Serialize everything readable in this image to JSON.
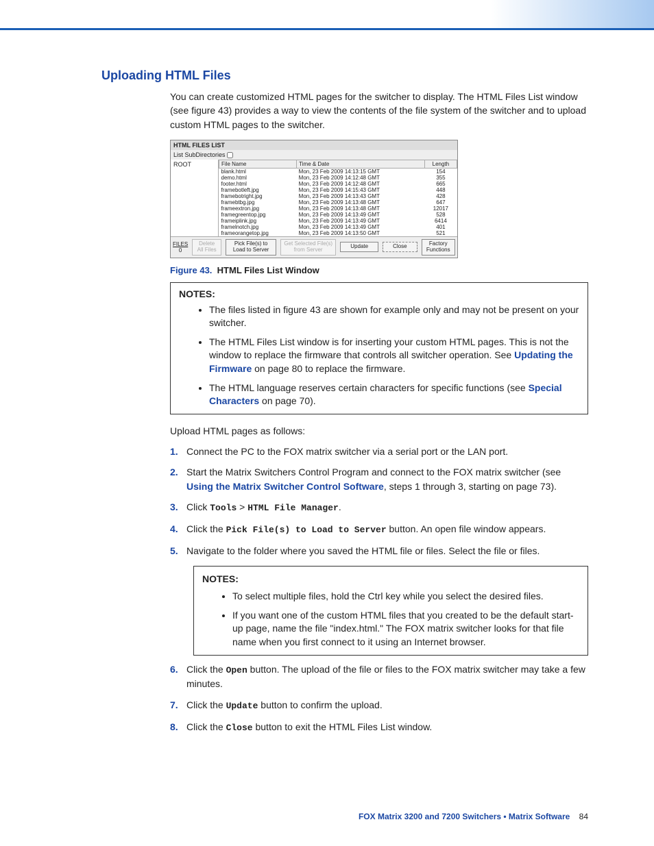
{
  "heading": "Uploading HTML Files",
  "intro": "You can create customized HTML pages for the switcher to display. The HTML Files List window (see figure 43) provides a way to view the contents of the file system of the switcher and to upload custom HTML pages to the switcher.",
  "window": {
    "title": "HTML FILES LIST",
    "subdir_label": "List SubDirectories",
    "root": "ROOT",
    "cols": {
      "name": "File Name",
      "date": "Time & Date",
      "len": "Length"
    },
    "rows": [
      {
        "name": "blank.html",
        "date": "Mon, 23 Feb 2009 14:13:15 GMT",
        "len": "154"
      },
      {
        "name": "demo.html",
        "date": "Mon, 23 Feb 2009 14:12:48 GMT",
        "len": "355"
      },
      {
        "name": "footer.html",
        "date": "Mon, 23 Feb 2009 14:12:48 GMT",
        "len": "665"
      },
      {
        "name": "framebotleft.jpg",
        "date": "Mon, 23 Feb 2009 14:15:43 GMT",
        "len": "448"
      },
      {
        "name": "framebotright.jpg",
        "date": "Mon, 23 Feb 2009 14:13:43 GMT",
        "len": "428"
      },
      {
        "name": "framebtbg.jpg",
        "date": "Mon, 23 Feb 2009 14:13:48 GMT",
        "len": "647"
      },
      {
        "name": "frameextron.jpg",
        "date": "Mon, 23 Feb 2009 14:13:48 GMT",
        "len": "12017"
      },
      {
        "name": "framegreentop.jpg",
        "date": "Mon, 23 Feb 2009 14:13:49 GMT",
        "len": "528"
      },
      {
        "name": "frameiplink.jpg",
        "date": "Mon, 23 Feb 2009 14:13:49 GMT",
        "len": "6414"
      },
      {
        "name": "framelnotch.jpg",
        "date": "Mon, 23 Feb 2009 14:13:49 GMT",
        "len": "401"
      },
      {
        "name": "frameorangetop.jpg",
        "date": "Mon, 23 Feb 2009 14:13:50 GMT",
        "len": "521"
      }
    ],
    "files_count_label": "FILES",
    "files_count": "0",
    "btn_delete": "Delete All\nFiles",
    "btn_pick": "Pick File(s) to\nLoad to Server",
    "btn_getsel": "Get Selected\nFile(s) from Server",
    "btn_update": "Update",
    "btn_close": "Close",
    "btn_restore": "Factory\nFunctions"
  },
  "caption_label": "Figure 43.",
  "caption_text": "HTML Files List Window",
  "notes_label": "NOTES:",
  "notes1": {
    "i1": "The files listed in figure 43 are shown for example only and may not be present on your switcher.",
    "i2a": "The HTML Files List window is for inserting your custom HTML pages. This is not the window to replace the firmware that controls all switcher operation. See ",
    "i2link": "Updating the Firmware",
    "i2b": " on page 80 to replace the firmware.",
    "i3a": "The HTML language reserves certain characters for specific functions (see ",
    "i3link": "Special Characters",
    "i3b": " on page 70)."
  },
  "upload_para": "Upload HTML pages as follows:",
  "steps": {
    "s1": "Connect the PC to the FOX matrix switcher via a serial port or the LAN port.",
    "s2a": "Start the Matrix Switchers Control Program and connect to the FOX matrix switcher (see ",
    "s2link": "Using the Matrix Switcher Control Software",
    "s2b": ", steps 1 through 3, starting on page 73).",
    "s3_pre": "Click ",
    "s3_tools": "Tools",
    "s3_gt": " > ",
    "s3_hfm": "HTML File Manager",
    "s3_post": ".",
    "s4_pre": "Click the ",
    "s4_mono": "Pick File(s) to Load to Server",
    "s4_post": " button. An open file window appears.",
    "s5": "Navigate to the folder where you saved the HTML file or files. Select the file or files.",
    "s6_pre": "Click the ",
    "s6_mono": "Open",
    "s6_post": " button. The upload of the file or files to the FOX matrix switcher may take a few minutes.",
    "s7_pre": "Click the ",
    "s7_mono": "Update",
    "s7_post": " button to confirm the upload.",
    "s8_pre": "Click the ",
    "s8_mono": "Close",
    "s8_post": " button to exit the HTML Files List window."
  },
  "notes2": {
    "i1": "To select multiple files, hold the Ctrl key while you select the desired files.",
    "i2": "If you want one of the custom HTML files that you created to be the default start-up page, name the file \"index.html.\" The FOX matrix switcher looks for that file name when you first connect to it using an Internet browser."
  },
  "footer": {
    "title": "FOX Matrix 3200 and 7200 Switchers • Matrix Software",
    "page": "84"
  }
}
